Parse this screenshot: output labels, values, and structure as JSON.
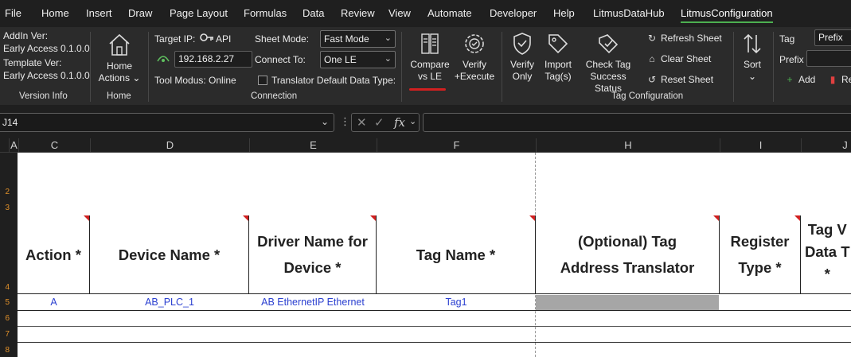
{
  "menu": {
    "items": [
      "File",
      "Home",
      "Insert",
      "Draw",
      "Page Layout",
      "Formulas",
      "Data",
      "Review",
      "View",
      "Automate",
      "Developer",
      "Help",
      "LitmusDataHub",
      "LitmusConfiguration"
    ],
    "active": "LitmusConfiguration"
  },
  "ribbon": {
    "version": {
      "addin_label": "AddIn Ver:",
      "addin_value": "Early Access 0.1.0.0",
      "template_label": "Template Ver:",
      "template_value": "Early Access 0.1.0.0",
      "group_label": "Version Info"
    },
    "home": {
      "button_line1": "Home",
      "button_line2": "Actions",
      "group_label": "Home"
    },
    "connection": {
      "target_ip_label": "Target IP:",
      "api_label": "API",
      "ip_value": "192.168.2.27",
      "tool_modus": "Tool Modus: Online",
      "sheet_mode_label": "Sheet Mode:",
      "sheet_mode_value": "Fast Mode",
      "connect_to_label": "Connect To:",
      "connect_to_value": "One LE",
      "translator_label": "Translator Default Data Type:",
      "group_label": "Connection"
    },
    "tag_config": {
      "compare_line1": "Compare",
      "compare_line2": "vs LE",
      "verify_exec_line1": "Verify",
      "verify_exec_line2": "+Execute",
      "verify_only_line1": "Verify",
      "verify_only_line2": "Only",
      "import_line1": "Import",
      "import_line2": "Tag(s)",
      "check_line1": "Check Tag",
      "check_line2": "Success Status",
      "refresh_sheet": "Refresh Sheet",
      "clear_sheet": "Clear Sheet",
      "reset_sheet": "Reset Sheet",
      "sort_label": "Sort",
      "group_label": "Tag Configuration"
    },
    "tag_panel": {
      "tag_label": "Tag",
      "tag_value": "Prefix",
      "prefix_label": "Prefix",
      "add_label": "Add",
      "remove_label": "Re"
    }
  },
  "formula_bar": {
    "name_box": "J14",
    "formula": ""
  },
  "grid": {
    "columns": [
      "A",
      "C",
      "D",
      "E",
      "F",
      "H",
      "I",
      "J"
    ],
    "row_numbers": [
      "2",
      "3",
      "4",
      "5",
      "6",
      "7",
      "8"
    ],
    "headers": {
      "action": "Action *",
      "device_name": "Device Name *",
      "driver_line1": "Driver Name for",
      "driver_line2": "Device *",
      "tag_name": "Tag Name *",
      "translator_line1": "(Optional) Tag",
      "translator_line2": "Address Translator",
      "register_line1": "Register",
      "register_line2": "Type *",
      "tagv_line1": "Tag V",
      "tagv_line2": "Data T",
      "tagv_line3": "*"
    },
    "row1": {
      "action": "A",
      "device_name": "AB_PLC_1",
      "driver": "AB EthernetIP Ethernet",
      "tag_name": "Tag1"
    }
  }
}
